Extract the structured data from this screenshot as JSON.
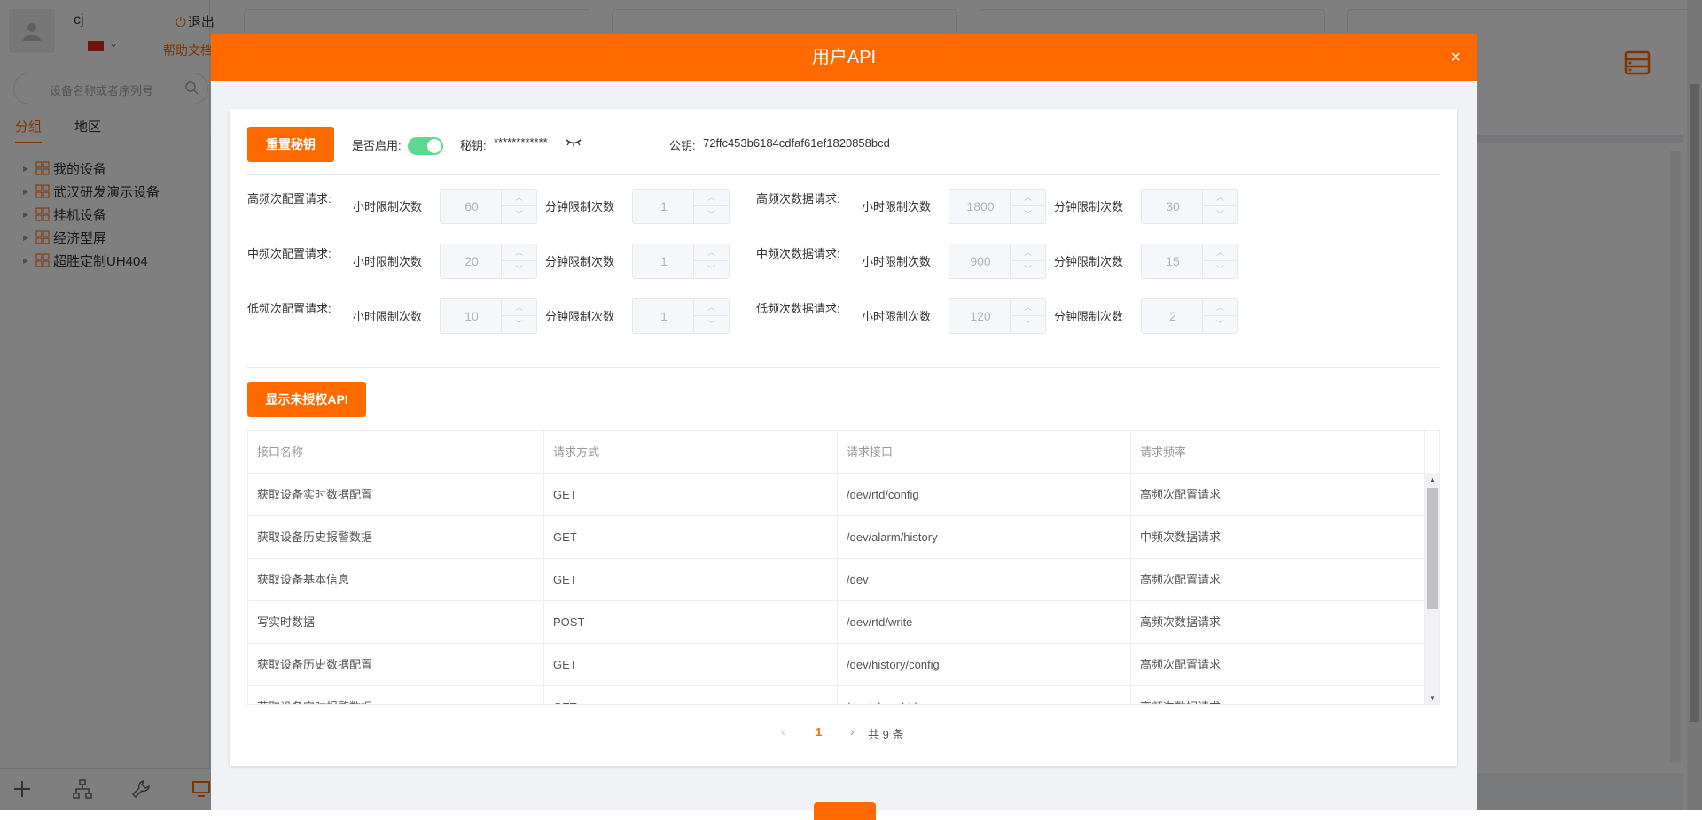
{
  "app": {
    "user": {
      "name": "cj",
      "logout_label": "退出",
      "help_label": "帮助文档"
    },
    "search": {
      "placeholder": "设备名称或者序列号"
    },
    "tabs": [
      {
        "label": "分组"
      },
      {
        "label": "地区"
      }
    ],
    "tree": [
      {
        "label": "我的设备"
      },
      {
        "label": "武汉研发演示设备"
      },
      {
        "label": "挂机设备"
      },
      {
        "label": "经济型屏"
      },
      {
        "label": "超胜定制UH404"
      }
    ]
  },
  "modal": {
    "title": "用户API",
    "close_label": "×",
    "reset_button": "重置秘钥",
    "enable_label": "是否启用:",
    "enabled": true,
    "secret_label": "秘钥:",
    "secret_value": "************",
    "public_label": "公钥:",
    "public_value": "72ffc453b6184cdfaf61ef1820858bcd",
    "hour_label": "小时限制次数",
    "minute_label": "分钟限制次数",
    "limits": [
      {
        "config_title": "高频次配置请求:",
        "config_hour": "60",
        "config_minute": "1",
        "data_title": "高频次数据请求:",
        "data_hour": "1800",
        "data_minute": "30"
      },
      {
        "config_title": "中频次配置请求:",
        "config_hour": "20",
        "config_minute": "1",
        "data_title": "中频次数据请求:",
        "data_hour": "900",
        "data_minute": "15"
      },
      {
        "config_title": "低频次配置请求:",
        "config_hour": "10",
        "config_minute": "1",
        "data_title": "低频次数据请求:",
        "data_hour": "120",
        "data_minute": "2"
      }
    ],
    "show_unauth_button": "显示未授权API",
    "table": {
      "columns": [
        "接口名称",
        "请求方式",
        "请求接口",
        "请求频率"
      ],
      "rows": [
        {
          "name": "获取设备实时数据配置",
          "method": "GET",
          "path": "/dev/rtd/config",
          "freq": "高频次配置请求"
        },
        {
          "name": "获取设备历史报警数据",
          "method": "GET",
          "path": "/dev/alarm/history",
          "freq": "中频次数据请求"
        },
        {
          "name": "获取设备基本信息",
          "method": "GET",
          "path": "/dev",
          "freq": "高频次配置请求"
        },
        {
          "name": "写实时数据",
          "method": "POST",
          "path": "/dev/rtd/write",
          "freq": "高频次数据请求"
        },
        {
          "name": "获取设备历史数据配置",
          "method": "GET",
          "path": "/dev/history/config",
          "freq": "高频次配置请求"
        },
        {
          "name": "获取设备实时报警数据",
          "method": "GET",
          "path": "/dev/alarm/rtd",
          "freq": "高频次数据请求"
        }
      ]
    },
    "pagination": {
      "current": "1",
      "total_label": "共 9 条"
    }
  },
  "colors": {
    "accent": "#ff6a00",
    "toggle_on": "#5cd98e"
  }
}
